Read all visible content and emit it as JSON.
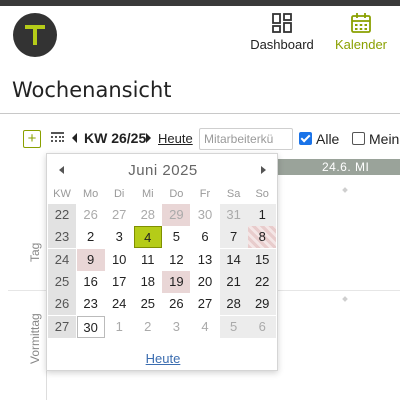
{
  "header": {
    "logo_letter": "T",
    "nav": [
      {
        "label": "Dashboard",
        "icon": "dashboard-grid-icon",
        "active": false
      },
      {
        "label": "Kalender",
        "icon": "calendar-icon",
        "active": true
      }
    ],
    "accent_color": "#8aa000"
  },
  "page": {
    "title": "Wochenansicht"
  },
  "toolbar": {
    "add_label": "+",
    "week_label": "KW 26/25",
    "today_label": "Heute",
    "employee_search": {
      "value": "",
      "placeholder": "Mitarbeiterkü"
    },
    "filter_all": {
      "label": "Alle",
      "checked": true
    },
    "filter_mine": {
      "label": "Mein",
      "checked": false
    }
  },
  "week_view": {
    "day_header": "24.6. MI",
    "rows": [
      "Tag",
      "Vormittag"
    ]
  },
  "datepicker": {
    "title": "Juni 2025",
    "headers": [
      "KW",
      "Mo",
      "Di",
      "Mi",
      "Do",
      "Fr",
      "Sa",
      "So"
    ],
    "weeks": [
      [
        "22",
        "26",
        "27",
        "28",
        "29",
        "30",
        "31",
        "1"
      ],
      [
        "23",
        "2",
        "3",
        "4",
        "5",
        "6",
        "7",
        "8"
      ],
      [
        "24",
        "9",
        "10",
        "11",
        "12",
        "13",
        "14",
        "15"
      ],
      [
        "25",
        "16",
        "17",
        "18",
        "19",
        "20",
        "21",
        "22"
      ],
      [
        "26",
        "23",
        "24",
        "25",
        "26",
        "27",
        "28",
        "29"
      ],
      [
        "27",
        "30",
        "1",
        "2",
        "3",
        "4",
        "5",
        "6"
      ]
    ],
    "selected_day": "4",
    "footer_label": "Heute"
  }
}
